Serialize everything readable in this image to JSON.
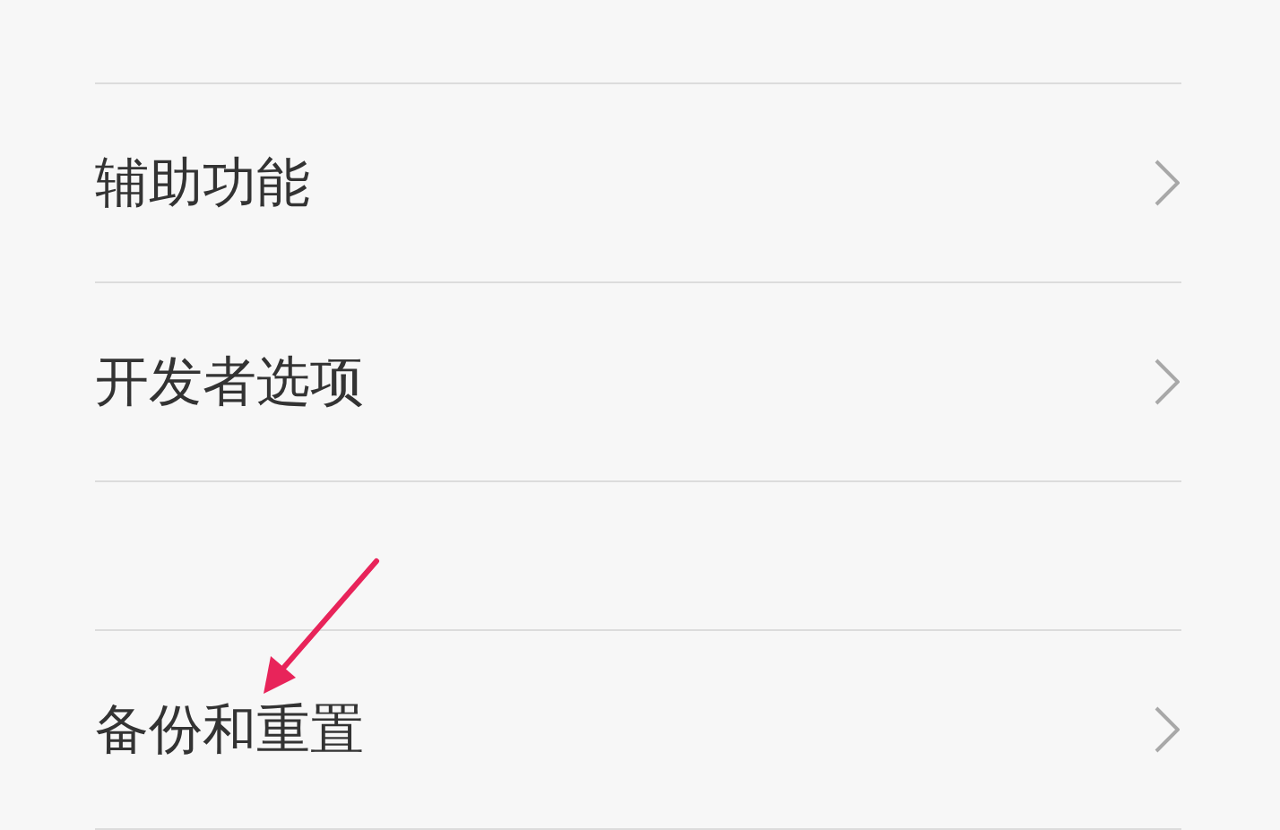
{
  "sections": [
    {
      "items": [
        {
          "label": "辅助功能"
        },
        {
          "label": "开发者选项"
        }
      ]
    },
    {
      "items": [
        {
          "label": "备份和重置"
        }
      ]
    }
  ]
}
